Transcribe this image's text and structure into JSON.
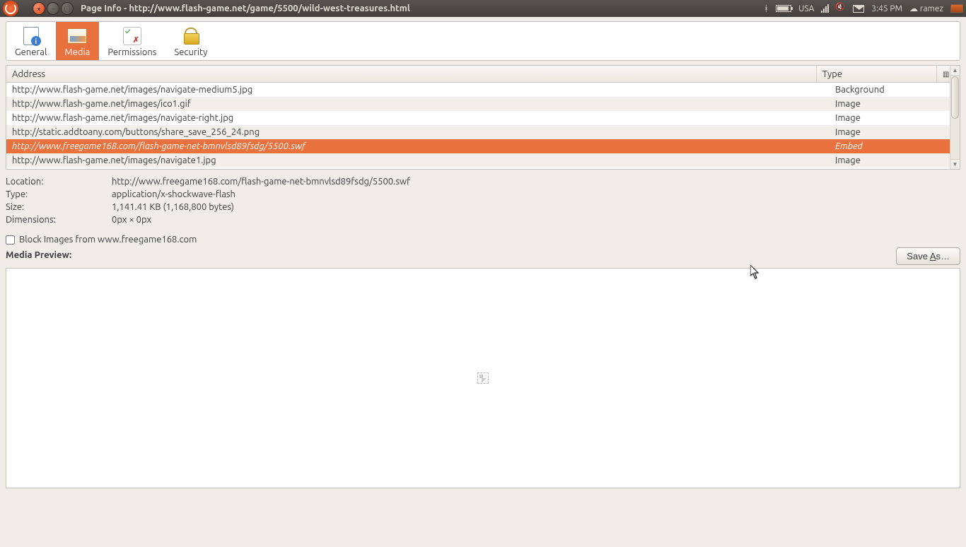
{
  "topbar": {
    "title": "Page Info - http://www.flash-game.net/game/5500/wild-west-treasures.html",
    "keyboard": "USA",
    "time": "3:45 PM",
    "user": "ramez"
  },
  "tabs": {
    "general": "General",
    "media": "Media",
    "permissions": "Permissions",
    "security": "Security"
  },
  "table": {
    "header_address": "Address",
    "header_type": "Type",
    "rows": [
      {
        "address": "http://www.flash-game.net/images/navigate-medium5.jpg",
        "type": "Background",
        "selected": false
      },
      {
        "address": "http://www.flash-game.net/images/ico1.gif",
        "type": "Image",
        "selected": false
      },
      {
        "address": "http://www.flash-game.net/images/navigate-right.jpg",
        "type": "Image",
        "selected": false
      },
      {
        "address": "http://static.addtoany.com/buttons/share_save_256_24.png",
        "type": "Image",
        "selected": false
      },
      {
        "address": "http://www.freegame168.com/flash-game-net-bmnvlsd89fsdg/5500.swf",
        "type": "Embed",
        "selected": true
      },
      {
        "address": "http://www.flash-game.net/images/navigate1.jpg",
        "type": "Image",
        "selected": false
      }
    ]
  },
  "details": {
    "location_label": "Location:",
    "location_value": "http://www.freegame168.com/flash-game-net-bmnvlsd89fsdg/5500.swf",
    "type_label": "Type:",
    "type_value": "application/x-shockwave-flash",
    "size_label": "Size:",
    "size_value": "1,141.41 KB (1,168,800 bytes)",
    "dimensions_label": "Dimensions:",
    "dimensions_value": "0px × 0px"
  },
  "block": {
    "label": "Block Images from www.freegame168.com"
  },
  "preview": {
    "label": "Media Preview:"
  },
  "save": {
    "prefix": "Save ",
    "accel": "A",
    "suffix": "s…"
  }
}
